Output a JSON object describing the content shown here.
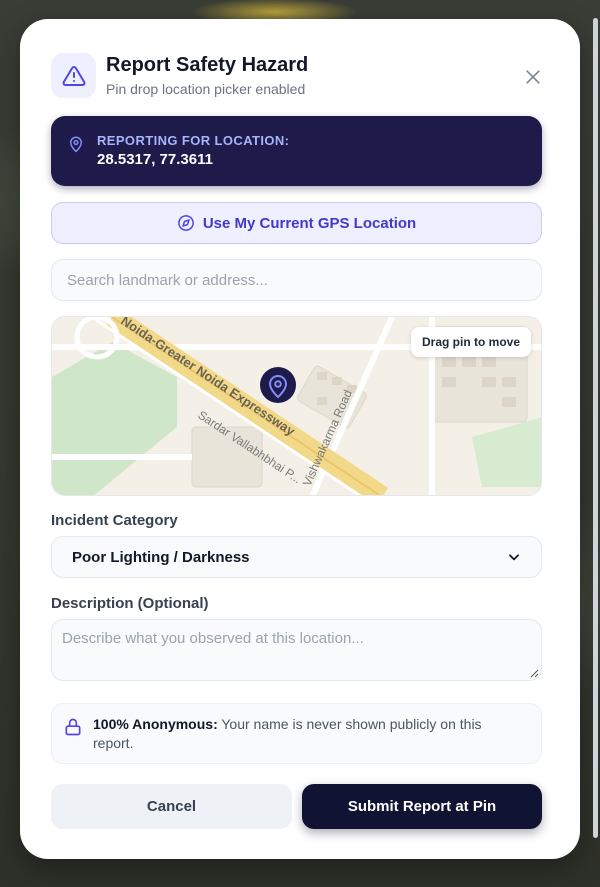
{
  "header": {
    "title": "Report Safety Hazard",
    "subtitle": "Pin drop location picker enabled"
  },
  "location_card": {
    "label": "REPORTING FOR LOCATION:",
    "coords": "28.5317, 77.3611"
  },
  "gps_button": {
    "label": "Use My Current GPS Location"
  },
  "search": {
    "placeholder": "Search landmark or address..."
  },
  "map": {
    "drag_hint": "Drag pin to move",
    "road_labels": [
      "Noida-Greater Noida Expressway",
      "Sardar Vallabhbhai P...",
      "Vishwakarma Road"
    ]
  },
  "category": {
    "label": "Incident Category",
    "selected": "Poor Lighting / Darkness"
  },
  "description": {
    "label": "Description (Optional)",
    "placeholder": "Describe what you observed at this location..."
  },
  "anonymous_note": {
    "bold": "100% Anonymous:",
    "text": " Your name is never shown publicly on this report."
  },
  "actions": {
    "cancel": "Cancel",
    "submit": "Submit Report at Pin"
  },
  "icons": {
    "header": "warning-triangle-icon",
    "close": "close-icon",
    "location": "map-pin-icon",
    "gps": "compass-icon",
    "lock": "lock-icon"
  },
  "colors": {
    "accent": "#4f46e5",
    "location_card_bg": "#1e1b4b",
    "submit_bg": "#111332"
  }
}
